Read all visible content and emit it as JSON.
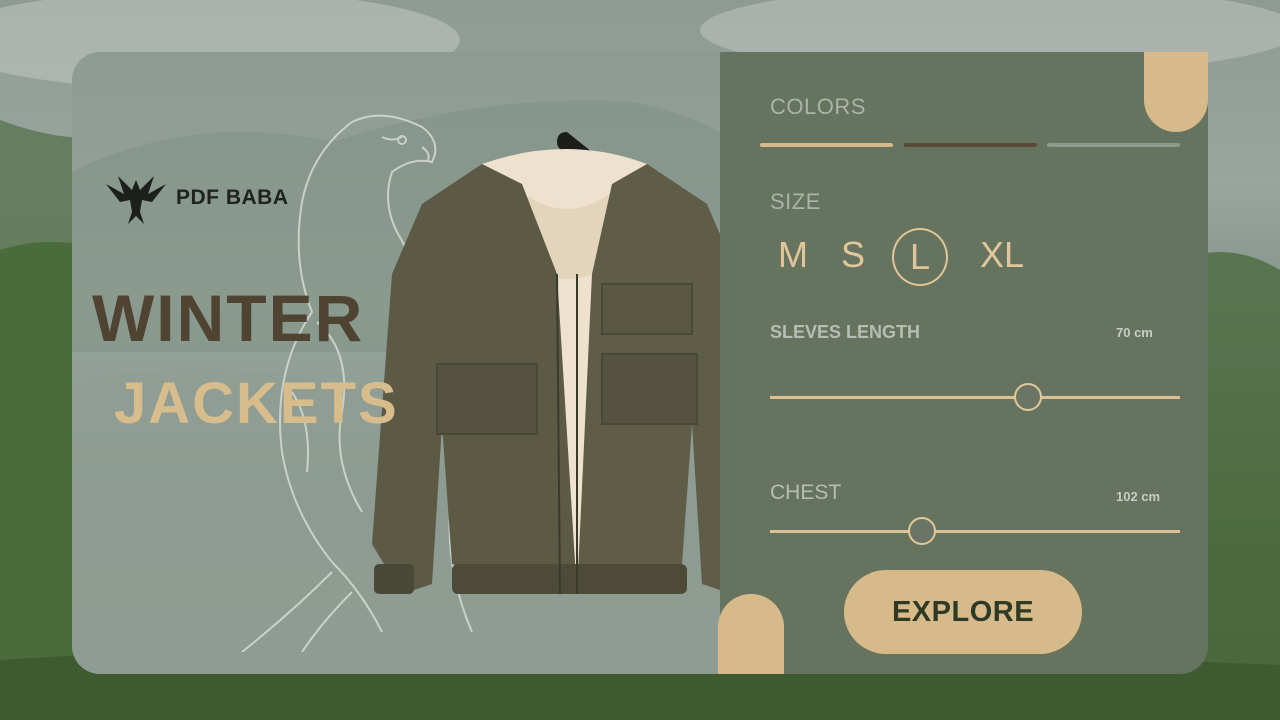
{
  "brand": {
    "name": "PDF BABA",
    "logo_icon": "phoenix-icon"
  },
  "headline": {
    "line1": "WINTER",
    "line2": "JACKETS"
  },
  "colors_section": {
    "label": "COLORS",
    "swatches": [
      "#d7ba8a",
      "#5a4a38",
      "#8e9a8c"
    ]
  },
  "size_section": {
    "label": "SIZE",
    "options": [
      "M",
      "S",
      "L",
      "XL"
    ],
    "selected": "L"
  },
  "sleeves": {
    "label": "SLEVES LENGTH",
    "value": "70 cm",
    "slider_fraction": 0.63
  },
  "chest": {
    "label": "CHEST",
    "value": "102 cm",
    "slider_fraction": 0.37
  },
  "cta": {
    "label": "EXPLORE"
  },
  "theme": {
    "accent": "#d7ba8a",
    "panel_dark": "#66735f",
    "panel_light": "#8d9b93",
    "headline_dark": "#4f4332"
  }
}
